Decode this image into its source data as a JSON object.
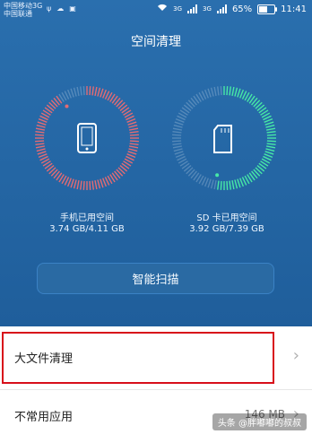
{
  "statusbar": {
    "carrier1": "中国移动3G",
    "carrier2": "中国联通",
    "net1": "3G",
    "net2": "3G",
    "battery_percent": "65%",
    "battery_level": 0.65,
    "time": "11:41"
  },
  "header": {
    "title": "空间清理"
  },
  "storage": [
    {
      "label": "手机已用空间",
      "usage": "3.74 GB/4.11 GB",
      "used_fraction": 0.91,
      "accent": "#e36b73"
    },
    {
      "label": "SD 卡已用空间",
      "usage": "3.92 GB/7.39 GB",
      "used_fraction": 0.53,
      "accent": "#47e8a6"
    }
  ],
  "actions": {
    "smart_scan": "智能扫描"
  },
  "list": {
    "large_files": {
      "label": "大文件清理"
    },
    "unused_apps": {
      "label": "不常用应用",
      "value": "146 MB"
    }
  },
  "watermark": "头条 @胖嘟嘟的叔叔",
  "colors": {
    "hero": "#1f5e9b",
    "highlight": "#d80f1a"
  }
}
